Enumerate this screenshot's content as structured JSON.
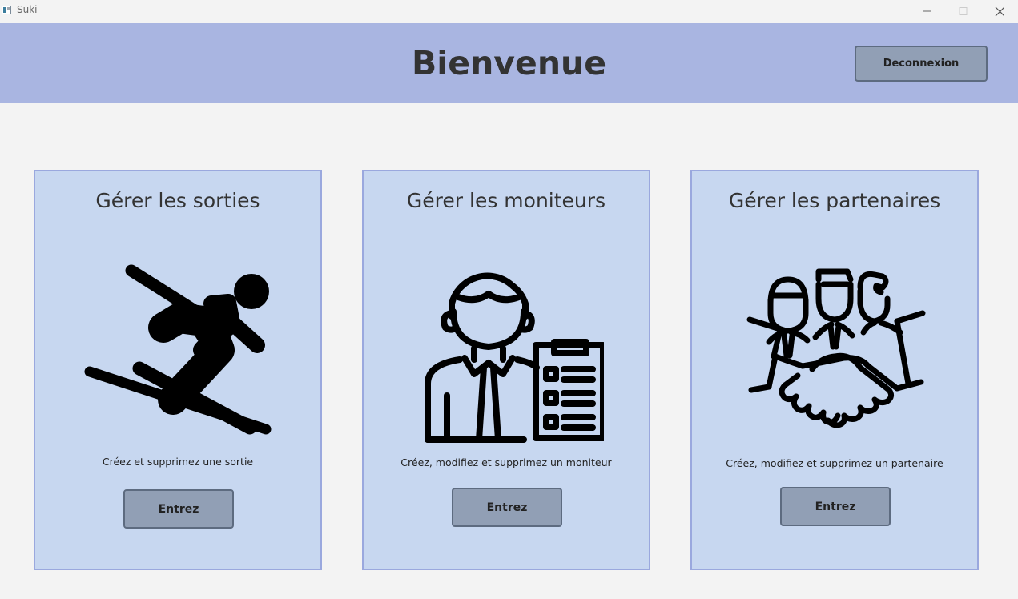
{
  "window": {
    "title": "Suki",
    "controls": {
      "minimize_icon": "minimize-icon",
      "maximize_icon": "maximize-icon",
      "close_icon": "close-icon"
    }
  },
  "header": {
    "title": "Bienvenue",
    "logout_label": "Deconnexion",
    "background": "#a9b5e1"
  },
  "cards": [
    {
      "title": "Gérer les sorties",
      "description": "Créez et supprimez une sortie",
      "button_label": "Entrez",
      "icon": "skier-icon"
    },
    {
      "title": "Gérer les moniteurs",
      "description": "Créez, modifiez et supprimez un moniteur",
      "button_label": "Entrez",
      "icon": "instructor-clipboard-icon"
    },
    {
      "title": "Gérer les partenaires",
      "description": "Créez, modifiez et supprimez un partenaire",
      "button_label": "Entrez",
      "icon": "partners-handshake-icon"
    }
  ],
  "colors": {
    "card_background": "#c7d7f0",
    "card_border": "#9aa8de",
    "button_background": "#919fb5",
    "button_border": "#5d6b80"
  }
}
